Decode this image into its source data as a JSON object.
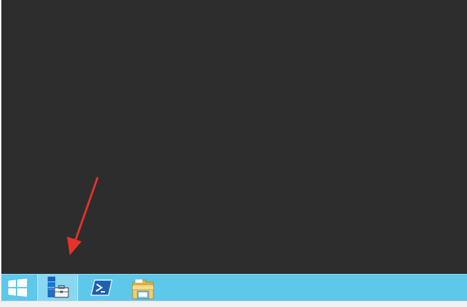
{
  "taskbar": {
    "items": [
      {
        "icon": "windows-logo-icon"
      },
      {
        "icon": "server-manager-icon",
        "active": true
      },
      {
        "icon": "powershell-icon"
      },
      {
        "icon": "file-explorer-icon"
      }
    ]
  },
  "annotation": {
    "icon": "red-arrow-icon",
    "color": "#e8312a"
  },
  "colors": {
    "desktop": "#2d2d2d",
    "taskbar": "#5ec8ea"
  }
}
